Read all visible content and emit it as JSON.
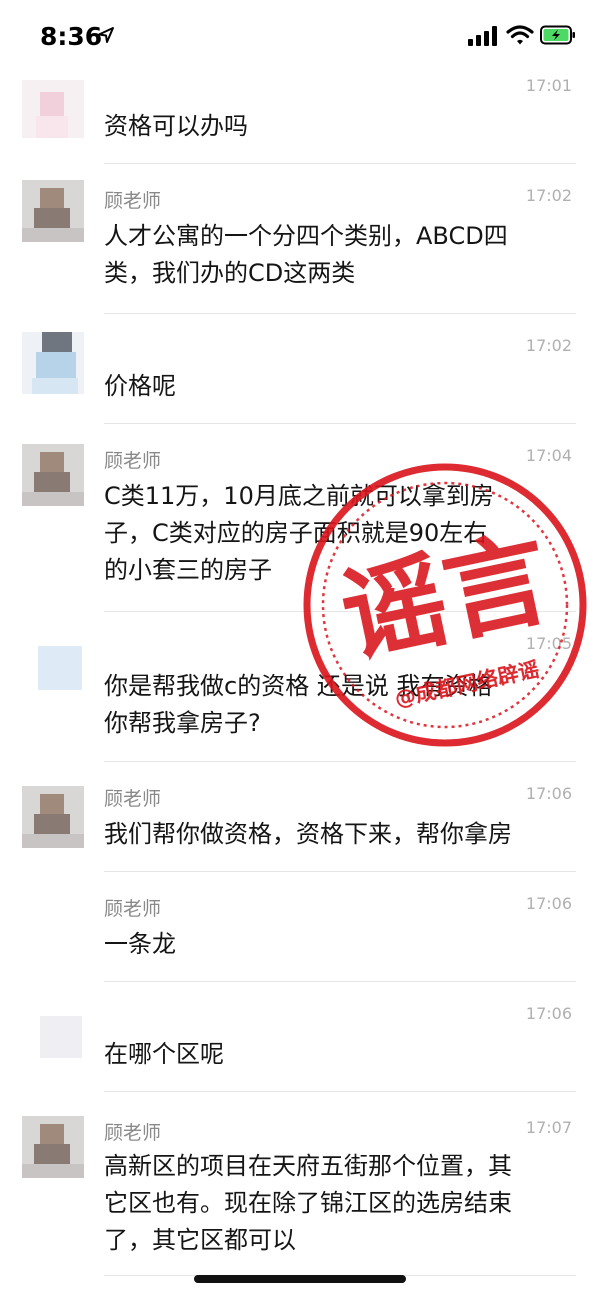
{
  "status_bar": {
    "time": "8:36"
  },
  "messages": [
    {
      "sender": "",
      "time": "17:01",
      "text": "资格可以办吗"
    },
    {
      "sender": "顾老师",
      "time": "17:02",
      "text": "人才公寓的一个分四个类别，ABCD四\n类，我们办的CD这两类"
    },
    {
      "sender": "",
      "time": "17:02",
      "text": "价格呢"
    },
    {
      "sender": "顾老师",
      "time": "17:04",
      "text": "C类11万，10月底之前就可以拿到房\n子，C类对应的房子面积就是90左右\n的小套三的房子"
    },
    {
      "sender": "",
      "time": "17:05",
      "text": "你是帮我做c的资格 还是说 我有资格\n你帮我拿房子?"
    },
    {
      "sender": "顾老师",
      "time": "17:06",
      "text": "我们帮你做资格，资格下来，帮你拿房"
    },
    {
      "sender": "顾老师",
      "time": "17:06",
      "text": "一条龙"
    },
    {
      "sender": "",
      "time": "17:06",
      "text": "在哪个区呢"
    },
    {
      "sender": "顾老师",
      "time": "17:07",
      "text": "高新区的项目在天府五街那个位置，其\n它区也有。现在除了锦江区的选房结束\n了，其它区都可以"
    }
  ],
  "stamp": {
    "main_text": "谣言",
    "sub_text": "@成都网络辟谣",
    "color": "#d9141b"
  },
  "colors": {
    "battery": "#4cd964",
    "divider": "#e6e6e6"
  }
}
